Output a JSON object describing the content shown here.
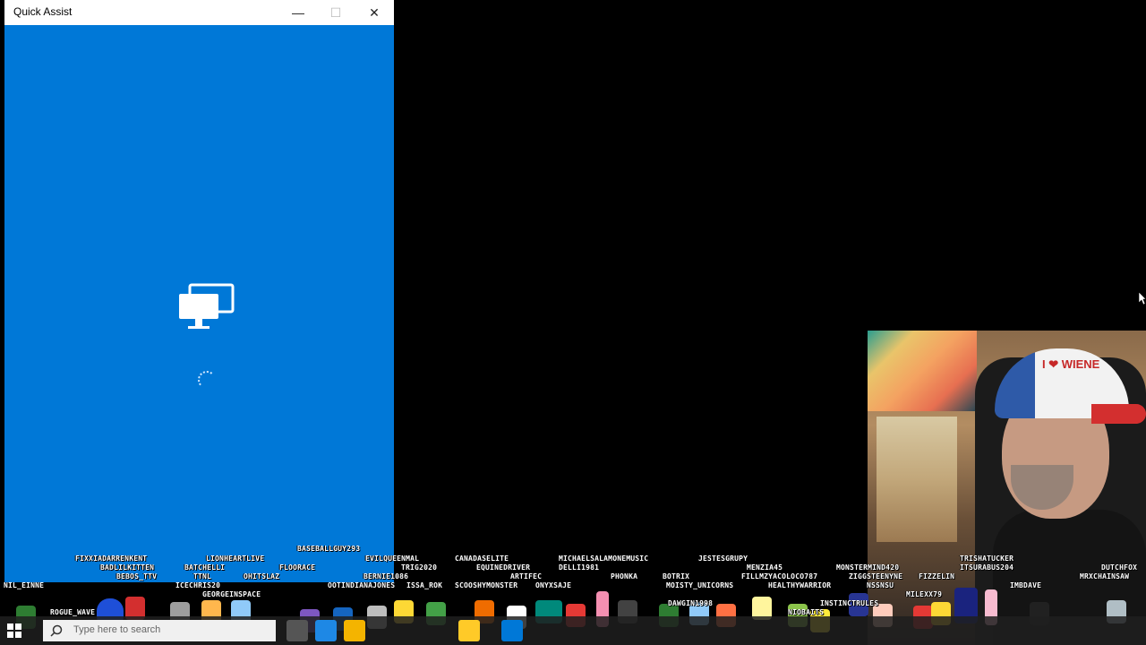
{
  "window": {
    "title": "Quick Assist",
    "minimize_glyph": "—",
    "maximize_glyph": "☐",
    "close_glyph": "✕",
    "background_color": "#0078d7",
    "status": "connecting-spinner"
  },
  "icons": {
    "main": "monitor-share-icon",
    "loading": "spinner-icon",
    "cursor": "mouse-cursor-icon"
  },
  "webcam": {
    "cap_text": "I ❤ WIENE"
  },
  "taskbar": {
    "search_placeholder": "Type here to search"
  },
  "chat_overlay": {
    "usernames": [
      "BASEBALLGUY293",
      "FIXXIADARRENKENT",
      "LIONHEARTLIVE",
      "EVILQUEENMAL",
      "CANADASELITE",
      "MICHAELSALAMONEMUSIC",
      "JESTESGRUPY",
      "TRISHATUCKER",
      "BADLILKITTEN",
      "BATCHELLI",
      "FLOORACE",
      "TRIG2020",
      "EQUINEDRIVER",
      "DELLI1981",
      "MENZIA45",
      "MONSTERMIND420",
      "ITSURABUS204",
      "DUTCHFOX",
      "BEBOS_TTV",
      "TTNL",
      "OHITSLAZ",
      "BERNIE1086",
      "ARTIFEC",
      "PHONKA",
      "BOTRIX",
      "FILLMZYACOLOCO787",
      "ZIGGSTEENYNE",
      "FIZZELIN",
      "MRXCHAINSAW",
      "NIL_EINNE",
      "ICECHRIS20",
      "OOTINDIANAJONES",
      "ISSA_ROK",
      "SCOOSHYMONSTER",
      "ONYXSAJE",
      "MOISTY_UNICORNS",
      "HEALTHYWARRIOR",
      "NSSNSU",
      "IMBDAVE",
      "GEORGEINSPACE",
      "DAWGIN1998",
      "INSTINCTRULES",
      "MILEXX79",
      "ROGUE_WAVE",
      "NIOBAITS"
    ]
  }
}
